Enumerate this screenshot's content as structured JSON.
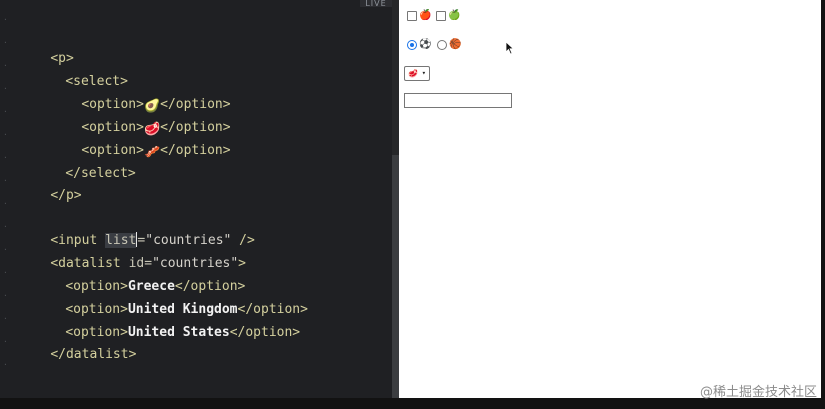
{
  "editor": {
    "live_label": "LIVE",
    "lines": [
      {
        "t1": "<p>"
      },
      {
        "t1": "<select>"
      },
      {
        "t1": "<option>",
        "emoji": "🥑",
        "t2": "</option>"
      },
      {
        "t1": "<option>",
        "emoji": "🥩",
        "t2": "</option>"
      },
      {
        "t1": "<option>",
        "emoji": "🥓",
        "t2": "</option>"
      },
      {
        "t1": "</select>"
      },
      {
        "t1": "</p>"
      },
      {
        "input_open": "<input ",
        "input_attr": "list",
        "input_eq": "=",
        "input_val": "\"countries\"",
        "input_close": " />"
      },
      {
        "dl_open": "<datalist ",
        "dl_attr": "id",
        "dl_eq": "=",
        "dl_val": "\"countries\"",
        "dl_close": ">"
      },
      {
        "t1": "<option>",
        "text": "Greece",
        "t2": "</option>"
      },
      {
        "t1": "<option>",
        "text": "United Kingdom",
        "t2": "</option>"
      },
      {
        "t1": "<option>",
        "text": "United States",
        "t2": "</option>"
      },
      {
        "t1": "</datalist>"
      }
    ]
  },
  "preview": {
    "checkbox_1_emoji": "🍎",
    "checkbox_2_emoji": "🍏",
    "radio_1_emoji": "⚽",
    "radio_2_emoji": "🏀",
    "radio_1_checked": true,
    "select_value": "🥩",
    "input_value": ""
  },
  "watermark": "@稀土掘金技术社区"
}
